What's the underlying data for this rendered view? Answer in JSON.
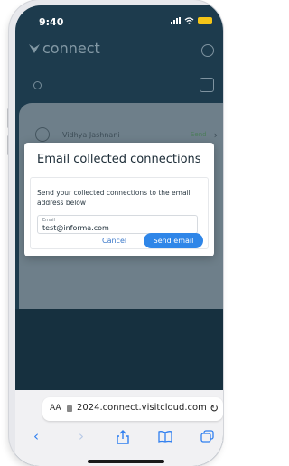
{
  "status_bar": {
    "time": "9:40"
  },
  "app": {
    "logo_text": "connect"
  },
  "list": {
    "row_name": "Vidhya Jashnani",
    "row_action": "Send"
  },
  "modal": {
    "title": "Email collected connections",
    "description": "Send your collected connections to the email address below",
    "email_label": "Email",
    "email_value": "test@informa.com",
    "cancel_label": "Cancel",
    "send_label": "Send email"
  },
  "safari": {
    "aa_label": "AA",
    "url": "2024.connect.visitcloud.com"
  },
  "colors": {
    "app_background": "#1d3b4d",
    "primary_button": "#2f86e8",
    "battery": "#f5c518"
  }
}
